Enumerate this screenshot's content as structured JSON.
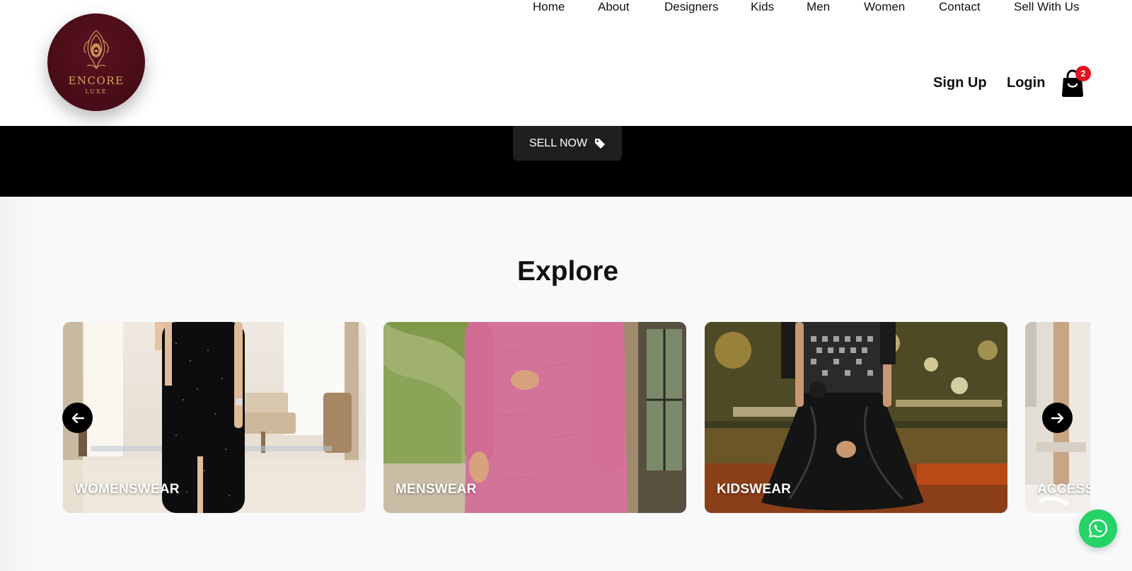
{
  "brand": {
    "name": "ENCORE",
    "tagline": "LUXE",
    "colors": {
      "primary": "#4a0d18",
      "gold": "#d6a85a"
    }
  },
  "nav": {
    "items": [
      {
        "label": "Home"
      },
      {
        "label": "About"
      },
      {
        "label": "Designers"
      },
      {
        "label": "Kids"
      },
      {
        "label": "Men"
      },
      {
        "label": "Women"
      },
      {
        "label": "Contact"
      },
      {
        "label": "Sell With Us"
      }
    ]
  },
  "auth": {
    "signup_label": "Sign Up",
    "login_label": "Login"
  },
  "cart": {
    "icon": "shopping-bag-icon",
    "count": "2"
  },
  "hero": {
    "sell_button_label": "SELL NOW",
    "sell_icon": "tag-icon"
  },
  "explore": {
    "title": "Explore",
    "categories": [
      {
        "label": "WOMENSWEAR"
      },
      {
        "label": "MENSWEAR"
      },
      {
        "label": "KIDSWEAR"
      },
      {
        "label": "ACCESSORIES"
      }
    ],
    "prev_icon": "arrow-left-icon",
    "next_icon": "arrow-right-icon"
  },
  "chat": {
    "icon": "whatsapp-icon",
    "color": "#25d366"
  }
}
